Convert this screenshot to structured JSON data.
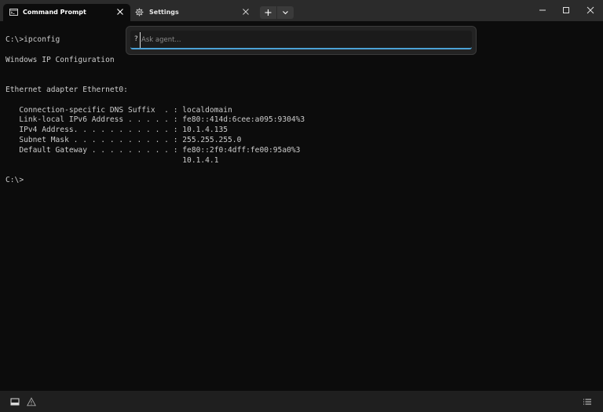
{
  "tabs": [
    {
      "title": "Command Prompt",
      "icon": "command-prompt-icon",
      "active": true
    },
    {
      "title": "Settings",
      "icon": "gear-icon",
      "active": false
    }
  ],
  "window_controls": [
    "minimize-icon",
    "maximize-icon",
    "close-icon"
  ],
  "terminal": {
    "lines": [
      "C:\\>ipconfig",
      "",
      "Windows IP Configuration",
      "",
      "",
      "Ethernet adapter Ethernet0:",
      "",
      "   Connection-specific DNS Suffix  . : localdomain",
      "   Link-local IPv6 Address . . . . . : fe80::414d:6cee:a095:9304%3",
      "   IPv4 Address. . . . . . . . . . . : 10.1.4.135",
      "   Subnet Mask . . . . . . . . . . . : 255.255.255.0",
      "   Default Gateway . . . . . . . . . : fe80::2f0:4dff:fe00:95a0%3",
      "                                       10.1.4.1",
      "",
      "C:\\>"
    ]
  },
  "agent": {
    "prefix": "?",
    "placeholder": "Ask agent...",
    "value": ""
  },
  "statusbar": {
    "icons": [
      "panel-icon",
      "warning-icon",
      "list-icon"
    ]
  },
  "colors": {
    "background": "#0c0c0c",
    "tabbar": "#2b2b2b",
    "text": "#cccccc",
    "accent": "#4ca2d6"
  }
}
